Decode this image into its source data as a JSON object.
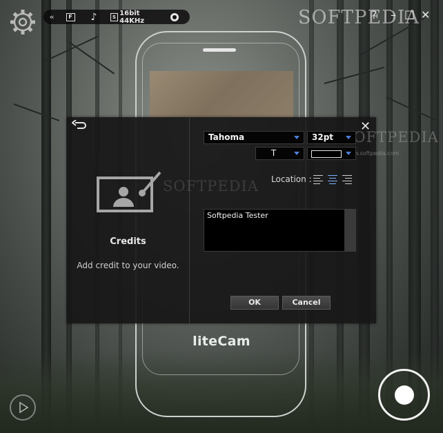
{
  "watermark": "SOFTPEDIA",
  "toolbar": {
    "collapse_icon": "double-chevron-left-icon",
    "screen_label": "F",
    "audio_icon": "music-note-icon",
    "audio_format": "16bit 44KHz",
    "webcam_icon": "webcam-icon"
  },
  "window": {
    "help": "?",
    "minimize": "–",
    "maximize": "□",
    "close": "✕"
  },
  "app": {
    "brand": "liteCam"
  },
  "dialog": {
    "title": "Credits",
    "description": "Add credit to your video.",
    "font_name": "Tahoma",
    "font_size": "32pt",
    "font_style": "T",
    "location_label": "Location :",
    "alignment_options": [
      "left",
      "center",
      "right"
    ],
    "alignment_selected": "center",
    "credit_text": "Softpedia Tester",
    "ok_label": "OK",
    "cancel_label": "Cancel",
    "close_label": "✕",
    "site_watermark": "www.softpedia.com"
  },
  "colors": {
    "dialog_bg": "#171717",
    "accent_caret": "#4f7fd6",
    "text": "#e8e8e8"
  }
}
